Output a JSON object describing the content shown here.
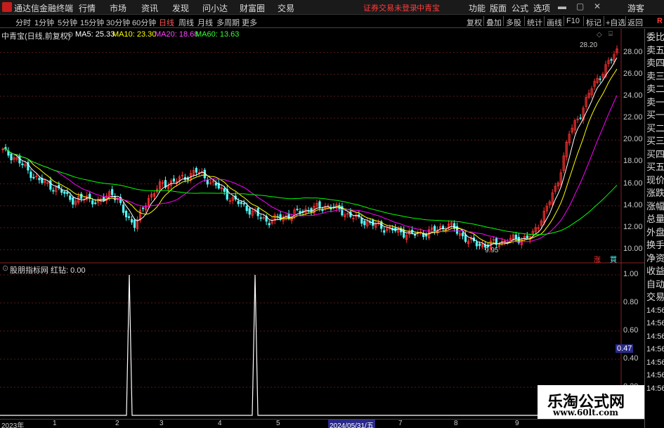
{
  "titlebar": {
    "app_name": "通达信金融终端",
    "menus": [
      "行情",
      "市场",
      "资讯",
      "发现",
      "问小达",
      "财富圈",
      "交易"
    ],
    "status": "证券交易未登录",
    "stock_name": "中青宝",
    "right_menus": [
      "功能",
      "版面",
      "公式",
      "选项"
    ],
    "user": "游客"
  },
  "periodbar": {
    "periods": [
      "分时",
      "1分钟",
      "5分钟",
      "15分钟",
      "30分钟",
      "60分钟",
      "日线",
      "周线",
      "月线",
      "多周期",
      "更多"
    ],
    "active_period": "日线",
    "tools": [
      "复权",
      "叠加",
      "多股",
      "统计",
      "画线",
      "F10",
      "标记",
      "+自选",
      "返回"
    ],
    "right_label": "R"
  },
  "main_header": {
    "title": "中青宝(日线,前复权)",
    "ma5": "MA5: 25.33",
    "ma10": "MA10: 23.30",
    "ma20": "MA20: 18.68",
    "ma60": "MA60: 13.63"
  },
  "price_axis": [
    "28.00",
    "26.00",
    "24.00",
    "22.00",
    "20.00",
    "18.00",
    "16.00",
    "14.00",
    "12.00",
    "10.00"
  ],
  "annotations": {
    "high": "28.20",
    "low": "9.95",
    "badge_up": "涨",
    "badge_down": "買"
  },
  "side_panel": [
    "委比",
    "卖五",
    "卖四",
    "卖三",
    "卖二",
    "卖一",
    "买一",
    "买二",
    "买三",
    "买四",
    "买五",
    "现价",
    "涨跌",
    "涨幅",
    "总量",
    "外盘",
    "换手",
    "净资",
    "收益",
    "自动",
    "交易",
    "14:56",
    "14:56",
    "14:56",
    "14:56",
    "14:56",
    "14:56",
    "14:56"
  ],
  "indicator": {
    "header": "股朋指标网  红钻: 0.00",
    "axis": [
      "1.00",
      "0.80",
      "0.60",
      "0.47",
      "0.40",
      "0.20"
    ],
    "cursor_value": "0.47"
  },
  "date_axis": {
    "year": "2023年",
    "months": [
      "1",
      "2",
      "3",
      "4",
      "5",
      "6",
      "7",
      "8",
      "9"
    ],
    "cursor_date": "2024/05/31/五"
  },
  "watermark": {
    "line1": "乐淘公式网",
    "line2": "www.60lt.com"
  },
  "colors": {
    "up": "#ff3232",
    "down": "#54fcfc",
    "ma5": "#ffffff",
    "ma10": "#ffff00",
    "ma20": "#ff00ff",
    "ma60": "#00ff00"
  },
  "chart_data": {
    "type": "candlestick",
    "title": "中青宝(日线,前复权)",
    "ylim": [
      9.5,
      29.0
    ],
    "close_series": [
      19.0,
      18.4,
      17.3,
      16.3,
      15.8,
      15.2,
      14.4,
      14.8,
      14.2,
      15.4,
      13.5,
      12.2,
      14.6,
      15.8,
      16.2,
      16.5,
      17.2,
      16.4,
      15.6,
      14.6,
      14.0,
      13.2,
      12.6,
      12.9,
      13.2,
      13.6,
      13.8,
      14.0,
      13.6,
      13.0,
      12.6,
      12.2,
      11.9,
      11.6,
      11.4,
      11.5,
      11.8,
      12.3,
      11.4,
      10.6,
      10.4,
      10.6,
      10.9,
      11.0,
      11.3,
      13.5,
      15.8,
      20.5,
      22.5,
      25.0,
      26.5,
      28.2
    ]
  },
  "indicator_data": {
    "type": "line",
    "name": "红钻",
    "spikes_at_x": [
      184,
      363
    ],
    "spike_value": 1.0
  }
}
